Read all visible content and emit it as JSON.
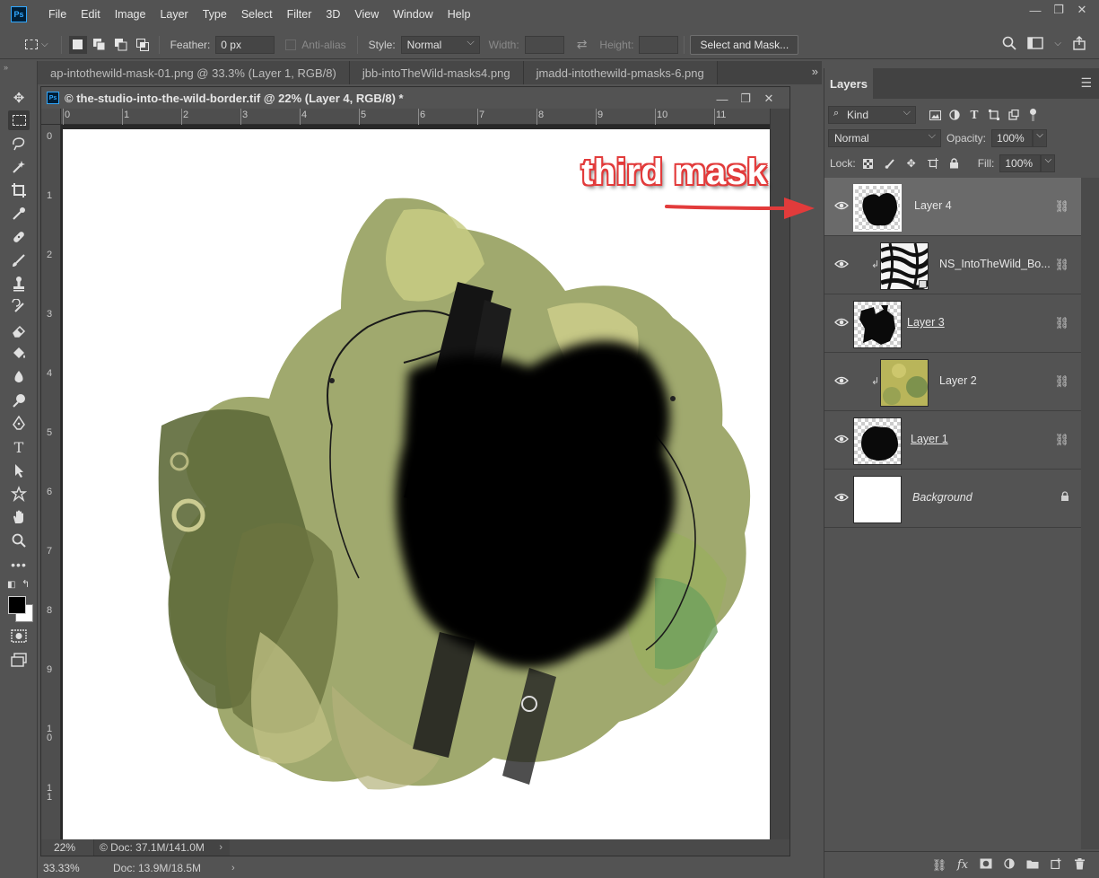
{
  "app": {
    "logo": "Ps"
  },
  "menu": [
    "File",
    "Edit",
    "Image",
    "Layer",
    "Type",
    "Select",
    "Filter",
    "3D",
    "View",
    "Window",
    "Help"
  ],
  "window_controls": {
    "minimize": "—",
    "restore": "❐",
    "close": "✕"
  },
  "options": {
    "feather_label": "Feather:",
    "feather_value": "0 px",
    "antialias_label": "Anti-alias",
    "style_label": "Style:",
    "style_value": "Normal",
    "width_label": "Width:",
    "height_label": "Height:",
    "select_mask_label": "Select and Mask..."
  },
  "tabs": [
    "ap-intothewild-mask-01.png @ 33.3% (Layer 1, RGB/8)",
    "jbb-intoTheWild-masks4.png",
    "jmadd-intothewild-pmasks-6.png"
  ],
  "tab_overflow": "»",
  "document": {
    "title": "© the-studio-into-the-wild-border.tif @ 22% (Layer 4, RGB/8) *",
    "zoom": "22%",
    "doc_info": "© Doc: 37.1M/141.0M",
    "ruler_h": [
      "0",
      "1",
      "2",
      "3",
      "4",
      "5",
      "6",
      "7",
      "8",
      "9",
      "10",
      "11"
    ],
    "ruler_v": [
      "0",
      "1",
      "2",
      "3",
      "4",
      "5",
      "6",
      "7",
      "8",
      "9",
      "1\n0",
      "1\n1"
    ]
  },
  "app_status": {
    "zoom": "33.33%",
    "doc_info": "Doc: 13.9M/18.5M"
  },
  "layers_panel": {
    "tab_label": "Layers",
    "filter_kind": "Kind",
    "blend_mode": "Normal",
    "opacity_label": "Opacity:",
    "opacity_value": "100%",
    "lock_label": "Lock:",
    "fill_label": "Fill:",
    "fill_value": "100%",
    "layers": [
      {
        "name": "Layer 4",
        "selected": true,
        "clipped": false,
        "thumb": "mask-black",
        "underline": false,
        "italic": false
      },
      {
        "name": "NS_IntoTheWild_Bo...",
        "selected": false,
        "clipped": true,
        "thumb": "zebra",
        "underline": false,
        "italic": false
      },
      {
        "name": "Layer 3",
        "selected": false,
        "clipped": false,
        "thumb": "mask-black",
        "underline": true,
        "italic": false
      },
      {
        "name": "Layer 2",
        "selected": false,
        "clipped": true,
        "thumb": "yellow-green",
        "underline": false,
        "italic": false
      },
      {
        "name": "Layer 1",
        "selected": false,
        "clipped": false,
        "thumb": "mask-black",
        "underline": true,
        "italic": false
      },
      {
        "name": "Background",
        "selected": false,
        "clipped": false,
        "thumb": "white",
        "underline": false,
        "italic": true
      }
    ]
  },
  "annotation": {
    "text": "third mask",
    "color": "#e23b3b"
  },
  "colors": {
    "ui_bg": "#535353",
    "panel_dark": "#424242",
    "selected_layer": "#6a6a6a",
    "accent_ps": "#31a8ff"
  }
}
